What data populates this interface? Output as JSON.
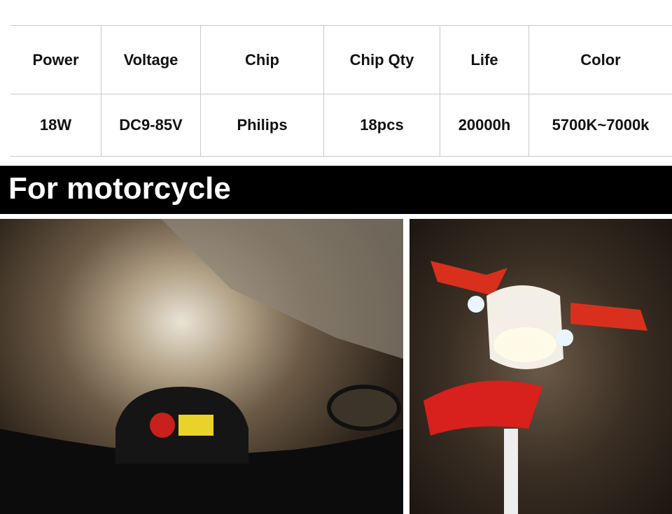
{
  "spec_table": {
    "headers": [
      "Power",
      "Voltage",
      "Chip",
      "Chip Qty",
      "Life",
      "Color"
    ],
    "values": [
      "18W",
      "DC9-85V",
      "Philips",
      "18pcs",
      "20000h",
      "5700K~7000k"
    ]
  },
  "banner": {
    "title": "For motorcycle"
  }
}
